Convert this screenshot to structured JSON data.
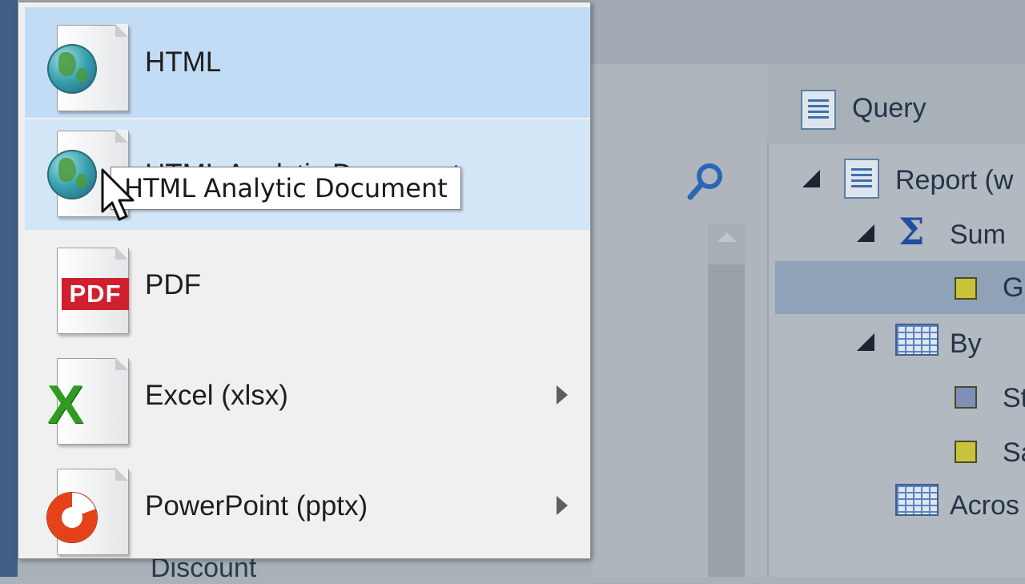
{
  "menu": {
    "items": [
      {
        "label": "HTML",
        "icon": "globe-icon",
        "has_submenu": false
      },
      {
        "label": "HTML Analytic Document",
        "icon": "globe-icon",
        "has_submenu": false
      },
      {
        "label": "PDF",
        "icon": "pdf-icon",
        "has_submenu": false
      },
      {
        "label": "Excel (xlsx)",
        "icon": "excel-icon",
        "has_submenu": true
      },
      {
        "label": "PowerPoint (pptx)",
        "icon": "powerpoint-icon",
        "has_submenu": true
      }
    ],
    "pdf_badge": "PDF"
  },
  "tooltip": {
    "text": "HTML Analytic Document"
  },
  "background": {
    "query_label": "Query",
    "tree": {
      "report": "Report (w",
      "sum": "Sum",
      "sum_child": "G",
      "by": "By",
      "by_child_1": "St",
      "by_child_2": "Sa",
      "across": "Acros"
    },
    "bottom_label": "Discount"
  },
  "colors": {
    "menu_highlight": "#c3dcf5",
    "menu_hover": "#d3e6f8",
    "pdf_red": "#d01f2d",
    "excel_green": "#2f9b1f",
    "powerpoint_orange": "#e5421a"
  }
}
